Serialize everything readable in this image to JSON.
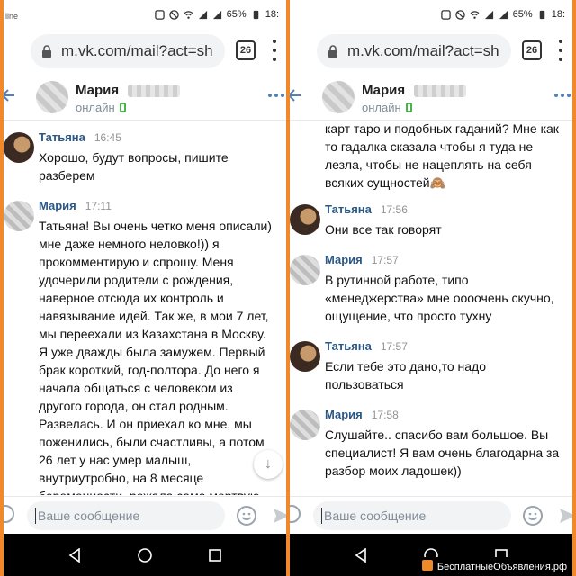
{
  "status": {
    "carrier": "line",
    "battery": "65%",
    "time": "18:"
  },
  "browser": {
    "url": "m.vk.com/mail?act=sh",
    "tab_count": "26"
  },
  "chat_header": {
    "name": "Мария",
    "status": "онлайн"
  },
  "composer": {
    "placeholder": "Ваше сообщение"
  },
  "colors": {
    "frame": "#f0892b",
    "author": "#2a5885",
    "online": "#4bb34b"
  },
  "left_messages": [
    {
      "author": "Татьяна",
      "time": "16:45",
      "text": "Хорошо, будут вопросы, пишите\nразберем"
    },
    {
      "author": "Мария",
      "time": "17:11",
      "text": "Татьяна! Вы очень четко меня описали)\nмне даже немного неловко!)) я\nпрокомментирую и спрошу. Меня\nудочерили родители с рождения,\nнаверное отсюда их контроль и\nнавязывание идей. Так же, в мои 7 лет,\nмы переехали из Казахстана в Москву.\nЯ уже дважды была замужем. Первый\nбрак короткий, год-полтора. До него я\nначала общаться с человеком из\nдругого города, он стал родным.\nРазвелась. И он приехал ко мне, мы\nпоженились, были счастливы, а потом\n26 лет у нас умер малыш,\nвнутриутробно, на 8 месяце\nбеременности, рожала сама мертвую"
    }
  ],
  "right_continuation": "карт таро и подобных гаданий? Мне как\nто гадалка сказала чтобы я туда не\nлезла, чтобы не нацеплять на себя\nвсяких сущностей🙈",
  "right_messages": [
    {
      "author": "Татьяна",
      "time": "17:56",
      "text": "Они все так говорят"
    },
    {
      "author": "Мария",
      "time": "17:57",
      "text": "В рутинной работе, типо\n«менеджерства» мне оооочень скучно,\nощущение, что просто тухну"
    },
    {
      "author": "Татьяна",
      "time": "17:57",
      "text": "Если тебе это дано,то надо\nпользоваться"
    },
    {
      "author": "Мария",
      "time": "17:58",
      "text": "Слушайте.. спасибо вам большое. Вы\nспециалист! Я вам очень благодарна за\nразбор моих ладошек))"
    }
  ],
  "watermark": "БесплатныеОбъявления.рф"
}
